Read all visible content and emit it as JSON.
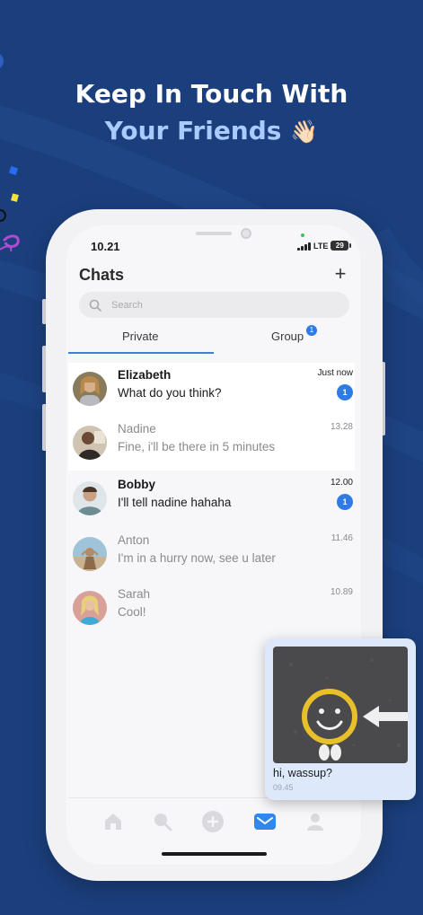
{
  "hero": {
    "line1": "Keep In Touch With",
    "line2": "Your Friends",
    "emoji": "👋🏻"
  },
  "status_bar": {
    "time": "10.21",
    "network": "LTE",
    "battery": "29"
  },
  "header": {
    "title": "Chats",
    "add_icon": "plus-icon"
  },
  "search": {
    "placeholder": "Search",
    "icon": "search-icon"
  },
  "tabs": [
    {
      "label": "Private",
      "active": true
    },
    {
      "label": "Group",
      "badge": "1"
    }
  ],
  "chats": [
    {
      "name": "Elizabeth",
      "message": "What do you think?",
      "time": "Just now",
      "unread": "1"
    },
    {
      "name": "Nadine",
      "message": "Fine, i'll be there in 5 minutes",
      "time": "13.28"
    },
    {
      "name": "Bobby",
      "message": "I'll tell nadine hahaha",
      "time": "12.00",
      "unread": "1"
    },
    {
      "name": "Anton",
      "message": "I'm in a hurry now, see u later",
      "time": "11.46"
    },
    {
      "name": "Sarah",
      "message": "Cool!",
      "time": "10.89"
    }
  ],
  "bottom_nav": [
    {
      "icon": "home-icon"
    },
    {
      "icon": "search-icon"
    },
    {
      "icon": "add-circle-icon"
    },
    {
      "icon": "mail-icon",
      "active": true
    },
    {
      "icon": "profile-icon"
    }
  ],
  "message_card": {
    "text": "hi, wassup?",
    "time": "09.45"
  },
  "colors": {
    "background": "#1b3f7d",
    "accent": "#2f7be6",
    "highlight_text": "#a9cbff",
    "card": "#dde9fb"
  }
}
